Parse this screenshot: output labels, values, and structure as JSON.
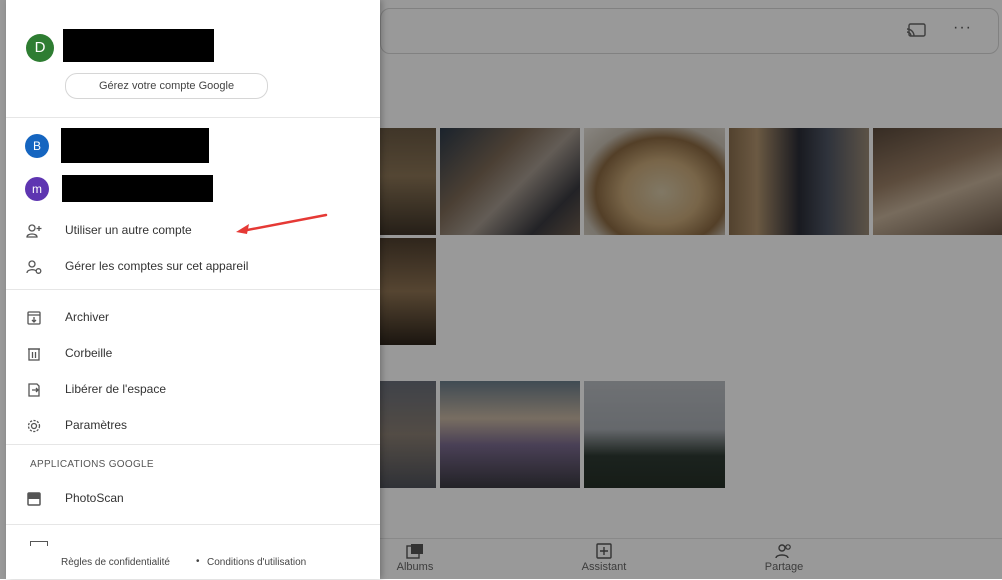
{
  "colors": {
    "avatar_d": "#2e7d32",
    "avatar_b": "#1565c0",
    "avatar_m": "#5e35b1",
    "annotation_arrow": "#e53935"
  },
  "drawer": {
    "primary_account": {
      "avatar_letter": "D"
    },
    "manage_account_label": "Gérez votre compte Google",
    "accounts": [
      {
        "avatar_letter": "B"
      },
      {
        "avatar_letter": "m"
      }
    ],
    "account_actions": [
      {
        "label": "Utiliser un autre compte",
        "icon": "add-person-icon"
      },
      {
        "label": "Gérer les comptes sur cet appareil",
        "icon": "manage-accounts-icon"
      }
    ],
    "menu": [
      {
        "label": "Archiver",
        "icon": "archive-icon"
      },
      {
        "label": "Corbeille",
        "icon": "trash-icon"
      },
      {
        "label": "Libérer de l'espace",
        "icon": "free-space-icon"
      },
      {
        "label": "Paramètres",
        "icon": "settings-gear-icon"
      }
    ],
    "section_title": "APPLICATIONS GOOGLE",
    "apps": [
      {
        "label": "PhotoScan",
        "icon": "photoscan-icon"
      }
    ],
    "footer": {
      "privacy": "Règles de confidentialité",
      "separator": "•",
      "terms": "Conditions d'utilisation"
    }
  },
  "bottom_nav": {
    "items": [
      {
        "label": "Albums",
        "icon": "albums-icon"
      },
      {
        "label": "Assistant",
        "icon": "assistant-icon"
      },
      {
        "label": "Partage",
        "icon": "sharing-icon"
      }
    ]
  },
  "toolbar": {
    "icons": [
      "cast-icon",
      "more-options-icon"
    ],
    "more_glyph": "···"
  }
}
